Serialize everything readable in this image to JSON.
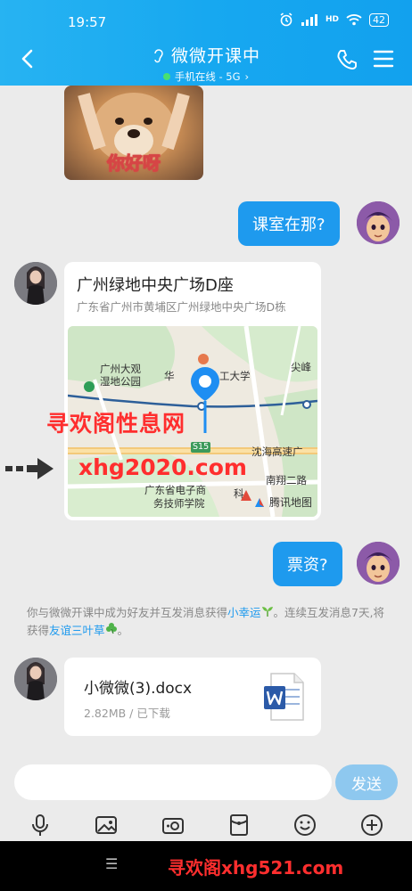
{
  "status": {
    "time": "19:57",
    "battery": "42",
    "signal": "HD"
  },
  "header": {
    "title": "微微开课中",
    "subtitle": "手机在线 - 5G"
  },
  "messages": {
    "sticker_text": "你好呀",
    "m1": "课室在那?",
    "location": {
      "title": "广州绿地中央广场D座",
      "address": "广东省广州市黄埔区广州绿地中央广场D栋",
      "labels": [
        "广州大观",
        "湿地公园",
        "华",
        "工大学",
        "尖峰",
        "S15",
        "沈海高速广",
        "南翔二路",
        "广东省电子商",
        "务技师学院",
        "科"
      ],
      "brand": "腾讯地图"
    },
    "m2": "票资?",
    "system": {
      "part1": "你与微微开课中成为好友并互发消息获得",
      "link1": "小幸运",
      "part2": "。连续互发消息7天,将获得",
      "link2": "友谊三叶草",
      "part3": "。"
    },
    "file": {
      "name": "小微微(3).docx",
      "meta": "2.82MB / 已下载"
    }
  },
  "watermarks": {
    "w1": "寻欢阁性息网",
    "w2": "xhg2020.com",
    "w3": "寻欢阁xhg521.com"
  },
  "input": {
    "placeholder": "",
    "send": "发送"
  },
  "colors": {
    "header": "#17a8f0",
    "bubble": "#1e9aee",
    "send_disabled": "#8ec8ef"
  }
}
